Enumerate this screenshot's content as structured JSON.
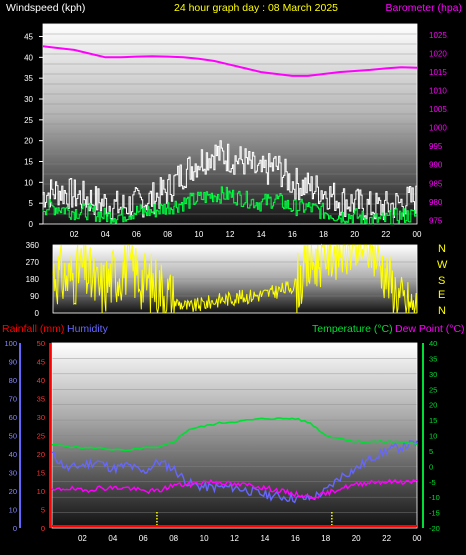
{
  "header": {
    "left_label": "Windspeed (kph)",
    "title": "24 hour graph day : 08 March 2025",
    "right_label": "Barometer (hpa)"
  },
  "compass": [
    "N",
    "W",
    "S",
    "E",
    "N"
  ],
  "lower_labels": {
    "rainfall": "Rainfall (mm)",
    "humidity": "Humidity",
    "temperature": "Temperature (°C)",
    "dewpoint": "Dew Point (°C)"
  },
  "colors": {
    "wind_gust": "#ffffff",
    "wind_avg": "#00ff40",
    "barometer": "#ff00ff",
    "direction": "#ffff00",
    "rainfall": "#ff0000",
    "humidity": "#6666ff",
    "temperature": "#00dd33",
    "dewpoint": "#ff00ff"
  },
  "chart_data": [
    {
      "type": "line",
      "title": "24 hour graph day : 08 March 2025",
      "x_ticks": [
        "02",
        "04",
        "06",
        "08",
        "10",
        "12",
        "14",
        "16",
        "18",
        "20",
        "22",
        "00"
      ],
      "left_axis": {
        "label": "Windspeed (kph)",
        "ticks": [
          "0",
          "5",
          "10",
          "15",
          "20",
          "25",
          "30",
          "35",
          "40",
          "45"
        ],
        "range": [
          0,
          48
        ]
      },
      "right_axis": {
        "label": "Barometer (hpa)",
        "ticks": [
          "975",
          "980",
          "985",
          "990",
          "995",
          "1000",
          "1005",
          "1010",
          "1015",
          "1020",
          "1025"
        ],
        "range": [
          974,
          1028
        ]
      },
      "series": [
        {
          "name": "Windspeed (kph)",
          "axis": "left",
          "x": [
            0,
            1,
            2,
            3,
            4,
            5,
            6,
            7,
            8,
            9,
            10,
            11,
            12,
            13,
            14,
            15,
            16,
            17,
            18,
            19,
            20,
            21,
            22,
            23,
            24
          ],
          "values": [
            7,
            8,
            7,
            6,
            5,
            4,
            5,
            6,
            8,
            12,
            15,
            17,
            16,
            15,
            12,
            14,
            10,
            9,
            8,
            6,
            5,
            4,
            4,
            5,
            6
          ]
        },
        {
          "name": "avg",
          "axis": "left",
          "x": [
            0,
            1,
            2,
            3,
            4,
            5,
            6,
            7,
            8,
            9,
            10,
            11,
            12,
            13,
            14,
            15,
            16,
            17,
            18,
            19,
            20,
            21,
            22,
            23,
            24
          ],
          "values": [
            4,
            4,
            3,
            3,
            2,
            2,
            3,
            3,
            4,
            5,
            6,
            7,
            7,
            6,
            5,
            6,
            4,
            4,
            3,
            2,
            2,
            1,
            1,
            2,
            2
          ]
        },
        {
          "name": "Barometer (hpa)",
          "axis": "right",
          "x": [
            0,
            1,
            2,
            3,
            4,
            5,
            6,
            7,
            8,
            9,
            10,
            11,
            12,
            13,
            14,
            15,
            16,
            17,
            18,
            19,
            20,
            21,
            22,
            23,
            24
          ],
          "values": [
            1022,
            1021.5,
            1021,
            1020,
            1019,
            1019,
            1019.2,
            1019.3,
            1019.2,
            1019,
            1018.6,
            1018,
            1017,
            1016,
            1015,
            1014.5,
            1014,
            1014,
            1014.5,
            1015,
            1015.3,
            1015.6,
            1016,
            1016.3,
            1016.2
          ]
        }
      ]
    },
    {
      "type": "line",
      "y_ticks": [
        "0",
        "90",
        "180",
        "270",
        "360"
      ],
      "ylim": [
        0,
        360
      ],
      "x_ticks": [],
      "series": [
        {
          "name": "Wind direction",
          "x": [
            0,
            1,
            2,
            3,
            4,
            5,
            6,
            7,
            8,
            9,
            10,
            11,
            12,
            13,
            14,
            15,
            16,
            17,
            18,
            19,
            20,
            21,
            22,
            23,
            24
          ],
          "values": [
            220,
            180,
            240,
            120,
            200,
            260,
            170,
            150,
            60,
            30,
            50,
            70,
            80,
            90,
            100,
            120,
            150,
            260,
            330,
            345,
            340,
            350,
            200,
            60,
            20
          ]
        }
      ]
    },
    {
      "type": "line",
      "x_ticks": [
        "02",
        "04",
        "06",
        "08",
        "10",
        "12",
        "14",
        "16",
        "18",
        "20",
        "22",
        "00"
      ],
      "left_axis_humidity": {
        "label": "Humidity",
        "ticks": [
          "0",
          "10",
          "20",
          "30",
          "40",
          "50",
          "60",
          "70",
          "80",
          "90",
          "100"
        ],
        "range": [
          0,
          100
        ]
      },
      "left_axis_rain": {
        "label": "Rainfall (mm)",
        "ticks": [
          "0",
          "5",
          "10",
          "15",
          "20",
          "25",
          "30",
          "35",
          "40",
          "45",
          "50"
        ],
        "range": [
          0,
          50
        ]
      },
      "right_axis": {
        "label": "Temperature (°C)",
        "ticks": [
          "-20",
          "-15",
          "-10",
          "-5",
          "0",
          "5",
          "10",
          "15",
          "20",
          "25",
          "30",
          "35",
          "40"
        ],
        "range": [
          -20,
          40
        ]
      },
      "series": [
        {
          "name": "Humidity",
          "axis": "humidity",
          "x": [
            0,
            1,
            2,
            3,
            4,
            5,
            6,
            7,
            8,
            9,
            10,
            11,
            12,
            13,
            14,
            15,
            16,
            17,
            18,
            19,
            20,
            21,
            22,
            23,
            24
          ],
          "values": [
            40,
            32,
            34,
            36,
            32,
            34,
            30,
            36,
            32,
            24,
            22,
            22,
            22,
            20,
            18,
            17,
            16,
            16,
            20,
            28,
            32,
            38,
            42,
            44,
            46
          ]
        },
        {
          "name": "Temperature (°C)",
          "axis": "temp",
          "x": [
            0,
            1,
            2,
            3,
            4,
            5,
            6,
            7,
            8,
            9,
            10,
            11,
            12,
            13,
            14,
            15,
            16,
            17,
            18,
            19,
            20,
            21,
            22,
            23,
            24
          ],
          "values": [
            7,
            6.5,
            6,
            6,
            5.5,
            5,
            6,
            6,
            8,
            12,
            13,
            14,
            14.5,
            15,
            15.5,
            15.5,
            15.5,
            14,
            10,
            9,
            8,
            8,
            8,
            8,
            7
          ]
        },
        {
          "name": "Dew Point (°C)",
          "axis": "temp",
          "x": [
            0,
            1,
            2,
            3,
            4,
            5,
            6,
            7,
            8,
            9,
            10,
            11,
            12,
            13,
            14,
            15,
            16,
            17,
            18,
            19,
            20,
            21,
            22,
            23,
            24
          ],
          "values": [
            -8,
            -7,
            -8,
            -7,
            -7,
            -7,
            -8,
            -8,
            -6,
            -6,
            -5,
            -5,
            -6,
            -6,
            -7,
            -8,
            -9,
            -10,
            -9,
            -7,
            -6,
            -5,
            -5,
            -5,
            -5
          ]
        },
        {
          "name": "Rainfall (mm)",
          "axis": "rain",
          "x": [
            0,
            24
          ],
          "values": [
            0,
            0
          ]
        }
      ]
    }
  ]
}
